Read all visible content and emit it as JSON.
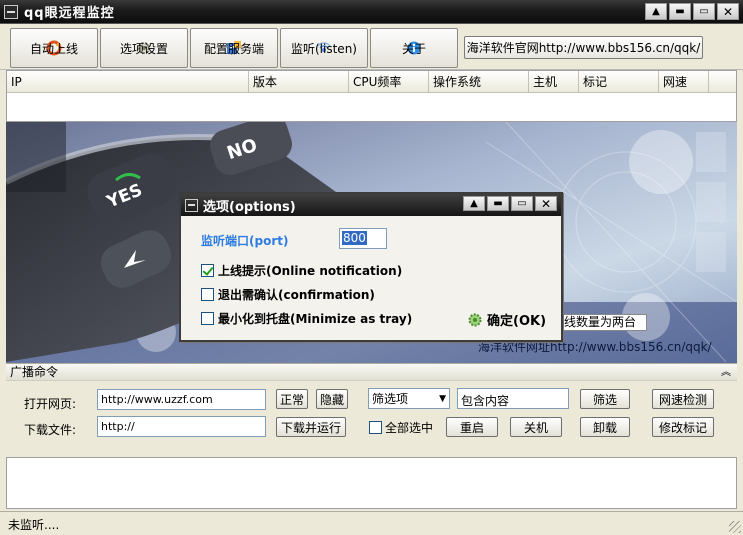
{
  "window": {
    "title": "qq眼远程监控"
  },
  "toolbar": {
    "buttons": [
      {
        "label": "自动上线",
        "icon": "refresh-icon"
      },
      {
        "label": "选项设置",
        "icon": "settings-icon"
      },
      {
        "label": "配置服务端",
        "icon": "server-config-icon"
      },
      {
        "label": "监听(listen)",
        "icon": "listen-icon"
      },
      {
        "label": "关于",
        "icon": "about-icon"
      }
    ],
    "website_button": "海洋软件官网http://www.bbs156.cn/qqk/"
  },
  "list": {
    "columns": [
      "IP",
      "版本",
      "CPU频率",
      "操作系统",
      "主机",
      "标记",
      "网速"
    ]
  },
  "banner": {
    "overlay_text": "线数量为两台",
    "url_text": "海洋软件网址http://www.bbs156.cn/qqk/"
  },
  "dialog": {
    "title": "选项(options)",
    "port_label": "监听端口(port)",
    "port_value": "800",
    "options": [
      {
        "label": "上线提示(Online notification)",
        "checked": true
      },
      {
        "label": "退出需确认(confirmation)",
        "checked": false
      },
      {
        "label": "最小化到托盘(Minimize as tray)",
        "checked": false
      }
    ],
    "ok_label": "确定(OK)"
  },
  "broadcast": {
    "header": "广播命令",
    "open_url_label": "打开网页:",
    "open_url_value": "http://www.uzzf.com",
    "normal_button": "正常",
    "hidden_button": "隐藏",
    "filter_select": "筛选项",
    "filter_value": "包含内容",
    "filter_button": "筛选",
    "speed_button": "网速检测",
    "download_label": "下载文件:",
    "download_value": "http://",
    "download_run_button": "下载并运行",
    "select_all_label": "全部选中",
    "restart_button": "重启",
    "shutdown_button": "关机",
    "uninstall_button": "卸载",
    "edit_mark_button": "修改标记"
  },
  "status": {
    "text": "未监听...."
  }
}
